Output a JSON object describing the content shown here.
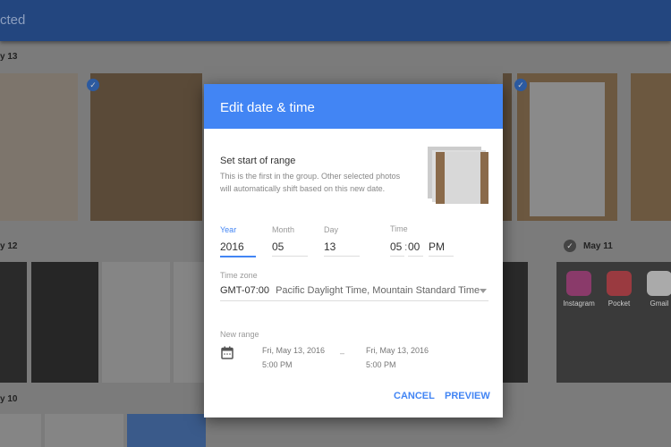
{
  "topbar": {
    "title": "cted"
  },
  "gallery": {
    "sections": [
      {
        "label": "y 13"
      },
      {
        "label": "y 12"
      },
      {
        "label": "May 11"
      },
      {
        "label": "y 10"
      }
    ],
    "apps": [
      {
        "label": "Instagram"
      },
      {
        "label": "Pocket"
      },
      {
        "label": "Gmail"
      }
    ]
  },
  "dialog": {
    "title": "Edit date & time",
    "heading": "Set start of range",
    "description": "This is the first in the group. Other selected photos will automatically shift based on this new date.",
    "year": {
      "label": "Year",
      "value": "2016"
    },
    "month": {
      "label": "Month",
      "value": "05"
    },
    "day": {
      "label": "Day",
      "value": "13"
    },
    "time": {
      "label": "Time",
      "hour": "05",
      "separator": ":",
      "minute": "00",
      "ampm": "PM"
    },
    "timezone": {
      "label": "Time zone",
      "offset": "GMT-07:00",
      "name": "Pacific Daylight Time, Mountain Standard Time"
    },
    "new_range": {
      "label": "New range",
      "start_date": "Fri, May 13, 2016",
      "start_time": "5:00 PM",
      "dash": "–",
      "end_date": "Fri, May 13, 2016",
      "end_time": "5:00 PM"
    },
    "cancel_label": "CANCEL",
    "preview_label": "PREVIEW"
  },
  "colors": {
    "accent": "#4285f4",
    "header_dimmed": "#23467f"
  }
}
